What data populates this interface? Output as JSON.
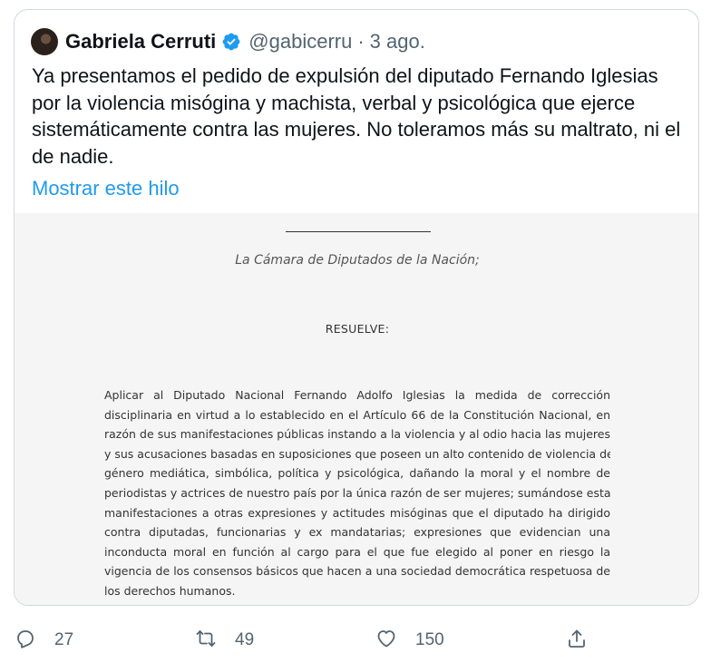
{
  "quoted_tweet": {
    "display_name": "Gabriela Cerruti",
    "handle": "@gabicerru",
    "separator": "·",
    "date": "3 ago.",
    "text": "Ya presentamos el pedido de expulsión del diputado Fernando Iglesias por la violencia misógina y machista, verbal y psicológica que ejerce sistemáticamente contra las mujeres. No toleramos más su maltrato, ni el de nadie.",
    "show_thread": "Mostrar este hilo",
    "avatar_icon": "profile-photo",
    "verified_icon": "verified-badge-icon",
    "verified_color": "#1d9bf0"
  },
  "document": {
    "chamber": "La Cámara de Diputados de la Nación;",
    "resolves": "RESUELVE:",
    "body_lines": [
      "Aplicar al Diputado Nacional Fernando Adolfo Iglesias la medida de corrección",
      "disciplinaria en virtud a lo establecido en el Artículo 66 de la Constitución Nacional, en",
      "razón de sus manifestaciones públicas instando a la violencia y al odio hacia las mujeres",
      "y sus acusaciones basadas en suposiciones que poseen un alto contenido de violencia de",
      "género mediática, simbólica, política y psicológica, dañando la moral y el nombre de",
      "periodistas y actrices de nuestro país por la única razón de ser mujeres; sumándose estas",
      "manifestaciones a otras expresiones y actitudes misóginas que el diputado ha dirigido",
      "contra diputadas, funcionarias y ex mandatarias; expresiones que evidencian una",
      "inconducta moral en función al cargo para el que fue elegido al poner en riesgo la",
      "vigencia de los consensos básicos que hacen a una sociedad democrática respetuosa de",
      "los derechos humanos."
    ]
  },
  "actions": {
    "reply": {
      "icon": "reply-icon",
      "count": "27"
    },
    "retweet": {
      "icon": "retweet-icon",
      "count": "49"
    },
    "like": {
      "icon": "heart-icon",
      "count": "150"
    },
    "share": {
      "icon": "share-icon"
    }
  },
  "colors": {
    "text_primary": "#0f1419",
    "text_secondary": "#536471",
    "link": "#1d9bf0",
    "border": "#cfd9de"
  }
}
